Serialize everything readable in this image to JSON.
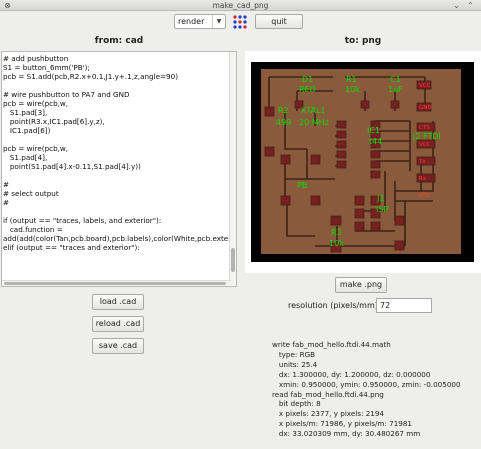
{
  "window": {
    "title": "make_cad_png"
  },
  "toolbar": {
    "mode_select": "render",
    "quit_label": "quit"
  },
  "left": {
    "heading": "from: cad",
    "code_lines": [
      "# add pushbutton",
      "S1 = button_6mm('PB');",
      "pcb = S1.add(pcb,R2.x+0.1,J1.y+.1,z,angle=90)",
      "",
      "# wire pushbutton to PA7 and GND",
      "pcb = wire(pcb,w,",
      "   S1.pad[3],",
      "   point(R3.x,IC1.pad[6].y,z),",
      "   IC1.pad[6])",
      "",
      "pcb = wire(pcb,w,",
      "   S1.pad[4],",
      "   point(S1.pad[4].x-0.11,S1.pad[4].y))",
      "",
      "#",
      "# select output",
      "#",
      "",
      "if (output == \"traces, labels, and exterior\"):",
      "   cad.function = add(add(color(Tan,pcb.board),pcb.labels),color(White,pcb.exterior))",
      "elif (output == \"traces and exterior\"):"
    ],
    "load_label": "load .cad",
    "reload_label": "reload .cad",
    "save_label": "save .cad"
  },
  "right": {
    "heading": "to: png",
    "make_label": "make .png",
    "resolution_label": "resolution (pixels/mm):",
    "resolution_value": "72",
    "log_lines": [
      "write fab_mod_hello.ftdi.44.math",
      "   type: RGB",
      "   units: 25.4",
      "   dx: 1.300000, dy: 1.200000, dz: 0.000000",
      "   xmin: 0.950000, ymin: 0.950000, zmin: -0.005000",
      "read fab_mod_hello.ftdi.44.png",
      "   bit depth: 8",
      "   x pixels: 2377, y pixels: 2194",
      "   x pixels/m: 71986, y pixels/m: 71981",
      "   dx: 33.020309 mm, dy: 30.480267 mm"
    ]
  },
  "pcb": {
    "colors": {
      "board": "#8a5a3c",
      "background": "#000000",
      "label": "#00e000",
      "pad_label": "#ff3b3b"
    },
    "labels": [
      {
        "id": "d1",
        "text": "D1"
      },
      {
        "id": "red",
        "text": "RED"
      },
      {
        "id": "r1",
        "text": "R1"
      },
      {
        "id": "r1v",
        "text": "10k"
      },
      {
        "id": "c1",
        "text": "C1"
      },
      {
        "id": "c1v",
        "text": "1uF"
      },
      {
        "id": "r2",
        "text": "R2"
      },
      {
        "id": "r2v",
        "text": "499"
      },
      {
        "id": "xtal",
        "text": "XTAL1"
      },
      {
        "id": "xtalv",
        "text": "20 MHz"
      },
      {
        "id": "ic1",
        "text": "IC1"
      },
      {
        "id": "ic1v",
        "text": "t44"
      },
      {
        "id": "j2",
        "text": "J2 FTDI"
      },
      {
        "id": "pb",
        "text": "PB"
      },
      {
        "id": "j1",
        "text": "J1"
      },
      {
        "id": "isp",
        "text": "ISP"
      },
      {
        "id": "r3",
        "text": "R3"
      },
      {
        "id": "r3v",
        "text": "10k"
      }
    ],
    "pad_labels": [
      {
        "id": "vcc",
        "text": "VCC"
      },
      {
        "id": "gnd",
        "text": "GND"
      },
      {
        "id": "cts",
        "text": "CTS"
      },
      {
        "id": "vcc2",
        "text": "VCC"
      },
      {
        "id": "tx",
        "text": "Tx"
      },
      {
        "id": "rx",
        "text": "Rx"
      },
      {
        "id": "rts",
        "text": "RTS"
      }
    ]
  }
}
